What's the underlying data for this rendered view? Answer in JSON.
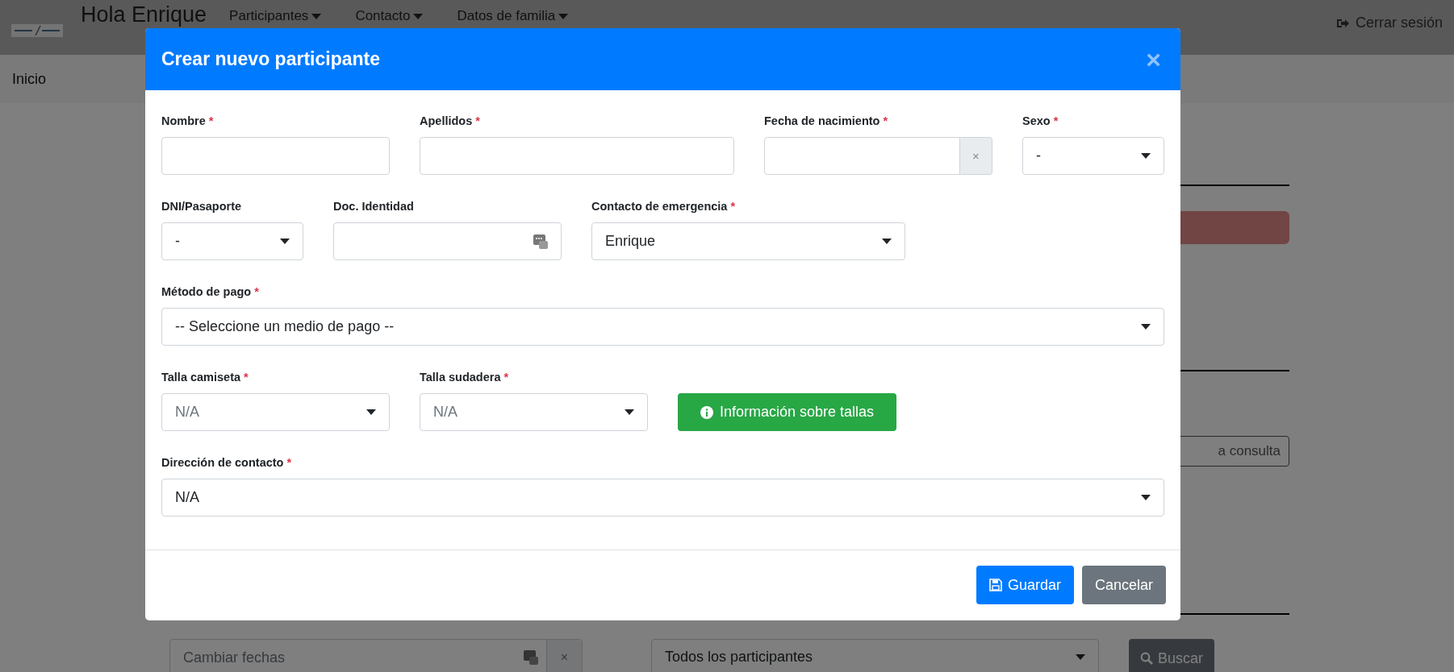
{
  "navbar": {
    "greeting": "Hola Enrique",
    "menus": [
      {
        "label": "Participantes"
      },
      {
        "label": "Contacto"
      },
      {
        "label": "Datos de familia"
      }
    ],
    "logout": "Cerrar sesión"
  },
  "breadcrumb": "Inicio",
  "page": {
    "search_placeholder": "a consulta",
    "date_filter": {
      "placeholder": "Cambiar fechas",
      "clear": "×"
    },
    "participant_filter": "Todos los participantes",
    "search_button": "Buscar"
  },
  "modal": {
    "title": "Crear nuevo participante",
    "close": "×",
    "rows": [
      [
        {
          "kind": "text",
          "label": "Nombre",
          "required_mark": "*"
        },
        {
          "kind": "text",
          "label": "Apellidos",
          "required_mark": "*"
        },
        {
          "kind": "date",
          "label": "Fecha de nacimiento",
          "required_mark": "*",
          "clear": "×"
        },
        {
          "kind": "select",
          "label": "Sexo",
          "required_mark": "*",
          "value": "-"
        }
      ],
      [
        {
          "kind": "select",
          "label": "DNI/Pasaporte",
          "value": "-"
        },
        {
          "kind": "id",
          "label": "Doc. Identidad"
        },
        {
          "kind": "select",
          "label": "Contacto de emergencia",
          "required_mark": "*",
          "value": "Enrique"
        }
      ],
      [
        {
          "kind": "select",
          "label": "Método de pago",
          "required_mark": "*",
          "value": "-- Seleccione un medio de pago --"
        }
      ],
      [
        {
          "kind": "select",
          "label": "Talla camiseta",
          "required_mark": "*",
          "placeholder": "N/A"
        },
        {
          "kind": "select",
          "label": "Talla sudadera",
          "required_mark": "*",
          "placeholder": "N/A"
        },
        {
          "kind": "button",
          "label": "Información sobre tallas"
        }
      ],
      [
        {
          "kind": "select",
          "label": "Dirección de contacto",
          "required_mark": "*",
          "value": "N/A"
        }
      ]
    ],
    "buttons": [
      {
        "kind": "save",
        "label": "Guardar"
      },
      {
        "kind": "cancel",
        "label": "Cancelar"
      }
    ]
  }
}
